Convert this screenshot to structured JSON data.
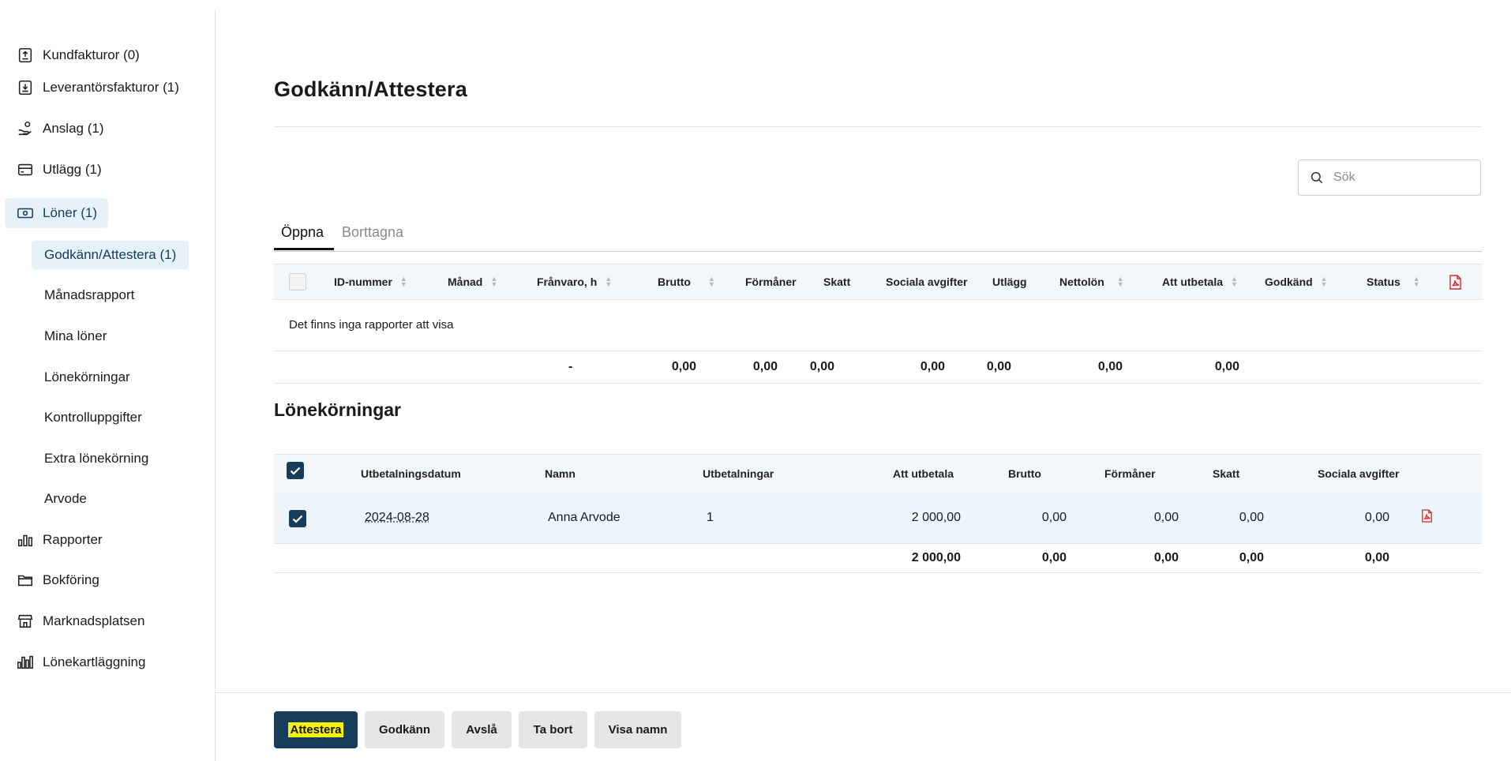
{
  "sidebar": {
    "items": [
      {
        "label": "Kundfakturor (0)",
        "icon": "invoice-out-icon"
      },
      {
        "label": "Leverantörsfakturor (1)",
        "icon": "invoice-in-icon"
      },
      {
        "label": "Anslag (1)",
        "icon": "hand-coin-icon"
      },
      {
        "label": "Utlägg (1)",
        "icon": "card-icon"
      },
      {
        "label": "Löner (1)",
        "icon": "banknote-icon",
        "active": true
      },
      {
        "label": "Rapporter",
        "icon": "bar-chart-icon"
      },
      {
        "label": "Bokföring",
        "icon": "folder-icon"
      },
      {
        "label": "Marknadsplatsen",
        "icon": "store-icon"
      },
      {
        "label": "Lönekartläggning",
        "icon": "chart-bars-icon"
      }
    ],
    "sub_items": [
      {
        "label": "Godkänn/Attestera (1)",
        "active": true
      },
      {
        "label": "Månadsrapport"
      },
      {
        "label": "Mina löner"
      },
      {
        "label": "Lönekörningar"
      },
      {
        "label": "Kontrolluppgifter"
      },
      {
        "label": "Extra lönekörning"
      },
      {
        "label": "Arvode"
      }
    ]
  },
  "page": {
    "title": "Godkänn/Attestera",
    "search_placeholder": "Sök"
  },
  "tabs": {
    "open": "Öppna",
    "deleted": "Borttagna"
  },
  "reports_table": {
    "headers": {
      "id": "ID-nummer",
      "month": "Månad",
      "absence": "Frånvaro, h",
      "gross": "Brutto",
      "benefits": "Förmåner",
      "tax": "Skatt",
      "social": "Sociala avgifter",
      "expenses": "Utlägg",
      "net": "Nettolön",
      "to_pay": "Att utbetala",
      "approved": "Godkänd",
      "status": "Status"
    },
    "empty_message": "Det finns inga rapporter att visa",
    "totals": {
      "absence": "-",
      "gross": "0,00",
      "benefits": "0,00",
      "tax": "0,00",
      "social": "0,00",
      "expenses": "0,00",
      "net": "0,00",
      "to_pay": "0,00"
    }
  },
  "payroll": {
    "title": "Lönekörningar",
    "headers": {
      "date": "Utbetalningsdatum",
      "name": "Namn",
      "payments": "Utbetalningar",
      "to_pay": "Att utbetala",
      "gross": "Brutto",
      "benefits": "Förmåner",
      "tax": "Skatt",
      "social": "Sociala avgifter"
    },
    "rows": [
      {
        "date": "2024-08-28",
        "name": "Anna Arvode",
        "payments": "1",
        "to_pay": "2 000,00",
        "gross": "0,00",
        "benefits": "0,00",
        "tax": "0,00",
        "social": "0,00"
      }
    ],
    "totals": {
      "to_pay": "2 000,00",
      "gross": "0,00",
      "benefits": "0,00",
      "tax": "0,00",
      "social": "0,00"
    }
  },
  "footer": {
    "attest": "Attestera",
    "approve": "Godkänn",
    "reject": "Avslå",
    "delete": "Ta bort",
    "show_names": "Visa namn"
  },
  "colors": {
    "primary": "#173d5c",
    "active_bg": "#e7f1f8",
    "pdf_red": "#e02424",
    "highlight": "#f4f20a"
  }
}
